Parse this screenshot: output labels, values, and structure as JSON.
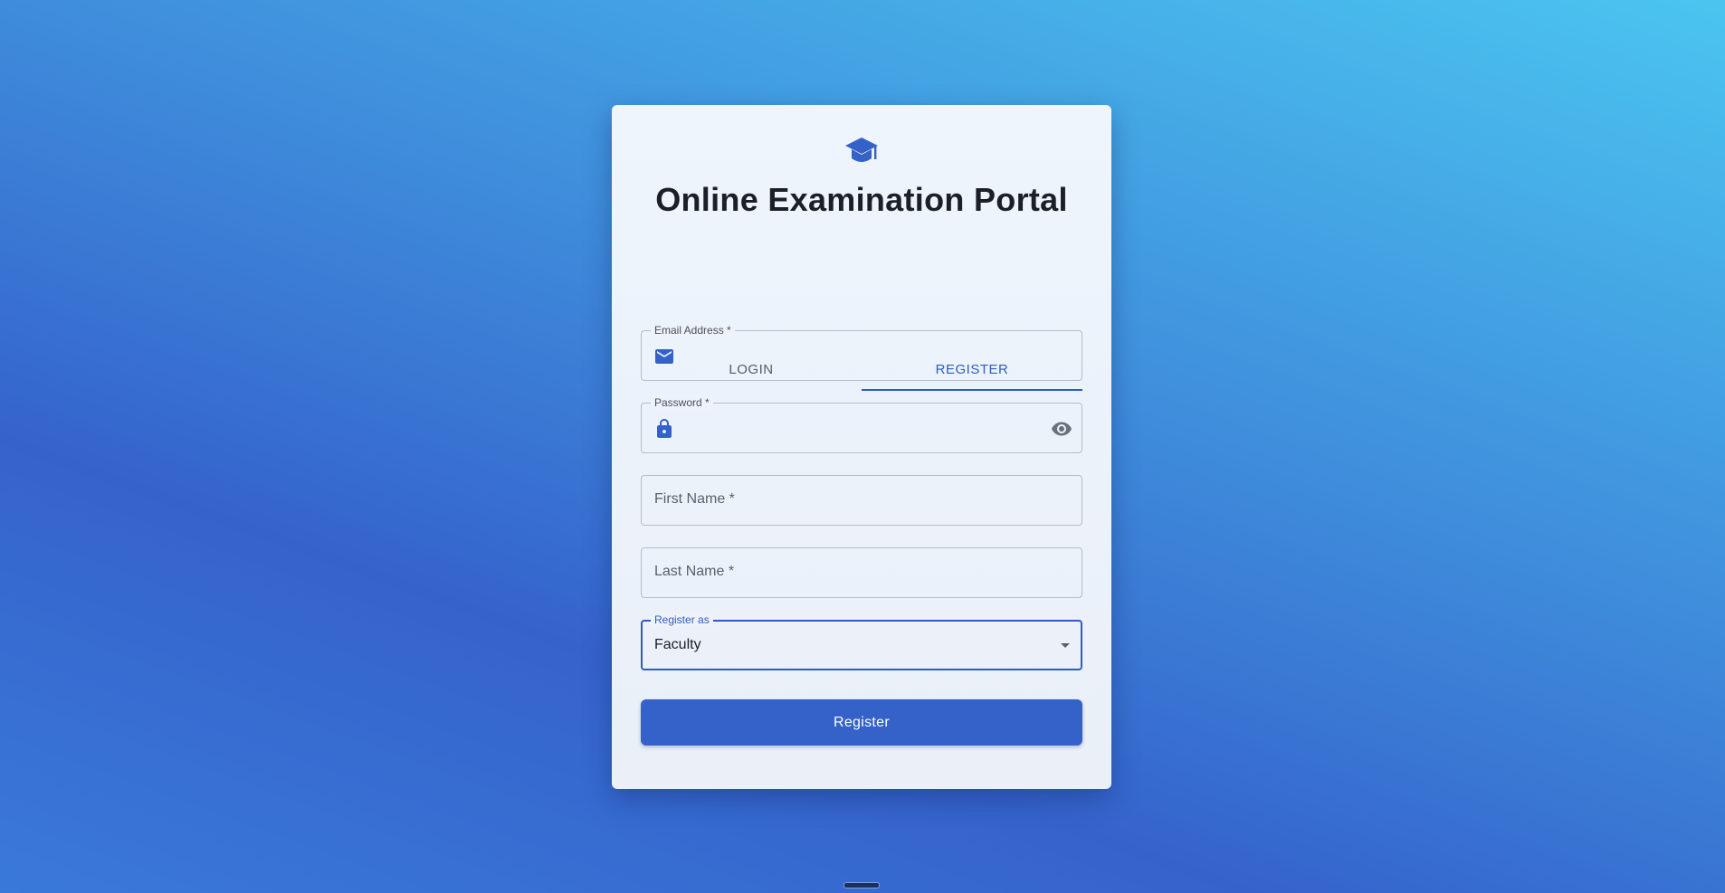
{
  "app": {
    "title": "Online Examination Portal",
    "logo_icon": "graduation-cap-icon"
  },
  "tabs": [
    {
      "label": "LOGIN",
      "active": false
    },
    {
      "label": "REGISTER",
      "active": true
    }
  ],
  "form": {
    "email": {
      "label": "Email Address *",
      "value": "",
      "icon": "email-icon"
    },
    "password": {
      "label": "Password *",
      "value": "",
      "icon": "lock-icon",
      "toggle_icon": "eye-icon"
    },
    "first_name": {
      "label": "First Name *",
      "value": ""
    },
    "last_name": {
      "label": "Last Name *",
      "value": ""
    },
    "role": {
      "label": "Register as",
      "value": "Faculty"
    },
    "submit_label": "Register"
  },
  "colors": {
    "accent": "#2f5dbd",
    "button": "#3462c8",
    "background_start": "#4bc5f0",
    "background_end": "#3563cc"
  }
}
